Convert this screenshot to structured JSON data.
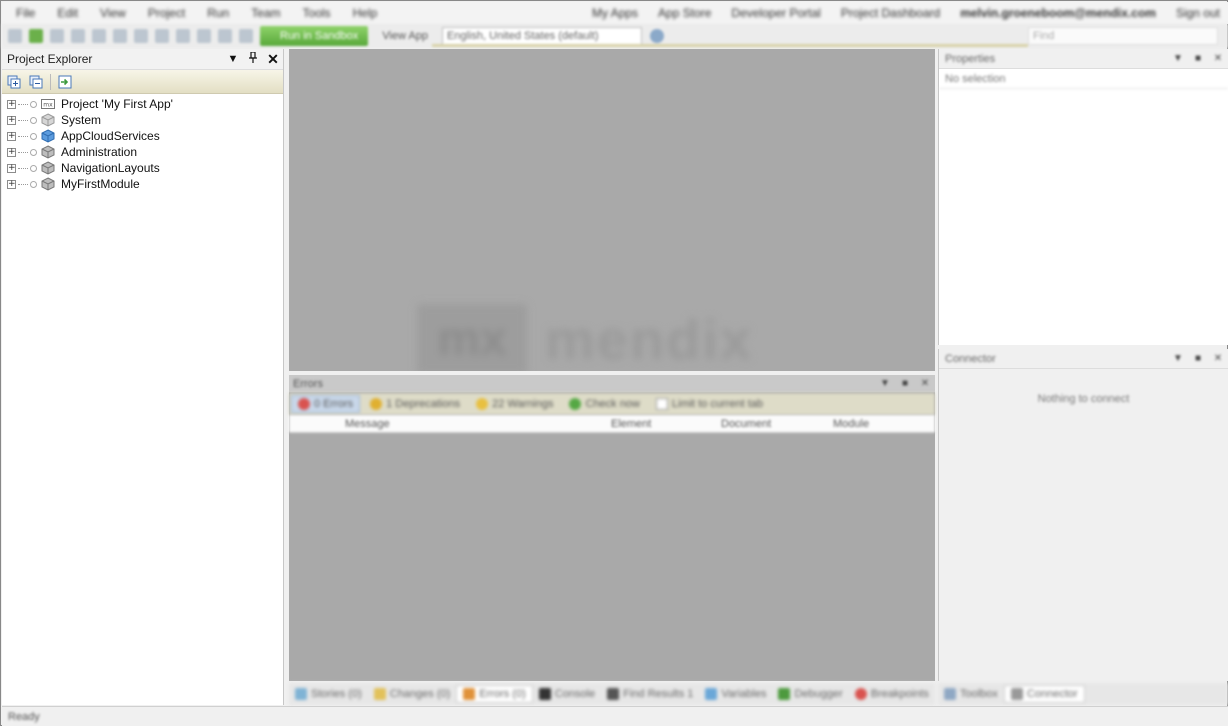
{
  "menu": {
    "items": [
      "File",
      "Edit",
      "View",
      "Project",
      "Run",
      "Team",
      "Tools",
      "Help"
    ],
    "right": [
      "My Apps",
      "App Store",
      "Developer Portal",
      "Project Dashboard"
    ],
    "user_email": "melvin.groeneboom@mendix.com",
    "sign_out": "Sign out"
  },
  "toolbar": {
    "run_label": "Run in Sandbox",
    "view_app_label": "View App",
    "language": "English, United States (default)",
    "search_placeholder": "Find"
  },
  "project_explorer": {
    "title": "Project Explorer",
    "tree": [
      {
        "label": "Project 'My First App'",
        "icon": "project-icon"
      },
      {
        "label": "System",
        "icon": "module-icon-gray"
      },
      {
        "label": "AppCloudServices",
        "icon": "module-icon-blue"
      },
      {
        "label": "Administration",
        "icon": "module-icon-gray"
      },
      {
        "label": "NavigationLayouts",
        "icon": "module-icon-gray"
      },
      {
        "label": "MyFirstModule",
        "icon": "module-icon-gray"
      }
    ]
  },
  "editor": {
    "watermark_box": "mx",
    "watermark_text": "mendix"
  },
  "errors": {
    "title": "Errors",
    "filters": [
      "0 Errors",
      "1 Deprecations",
      "22 Warnings",
      "Check now",
      "Limit to current tab"
    ],
    "columns": [
      "Message",
      "Element",
      "Document",
      "Module"
    ]
  },
  "properties": {
    "title": "Properties",
    "subtitle": "No selection"
  },
  "connector": {
    "title": "Connector",
    "message": "Nothing to connect"
  },
  "bottom_tabs": [
    "Stories (0)",
    "Changes (0)",
    "Errors (0)",
    "Console",
    "Find Results 1",
    "Variables",
    "Debugger",
    "Breakpoints"
  ],
  "right_tabs": [
    "Toolbox",
    "Connector"
  ],
  "status": "Ready",
  "colors": {
    "run_button": "#58a83a",
    "panel_toolbar": "#e3dfc4",
    "editor_bg": "#a9a9a9"
  }
}
